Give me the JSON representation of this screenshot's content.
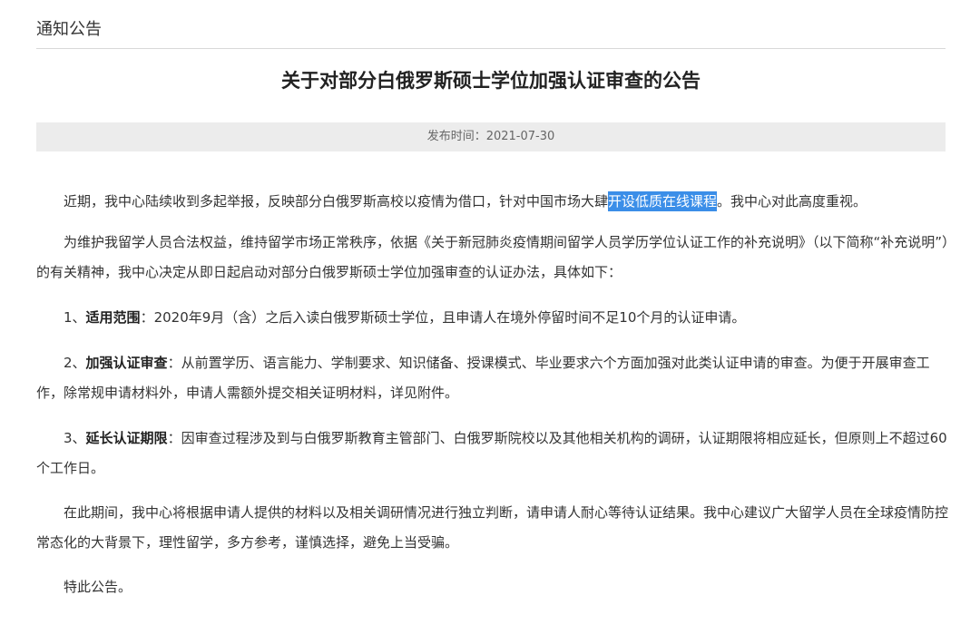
{
  "section": {
    "title": "通知公告"
  },
  "article": {
    "title": "关于对部分白俄罗斯硕士学位加强认证审查的公告",
    "publish_label": "发布时间：",
    "publish_date": "2021-07-30",
    "p1": {
      "before": "近期，我中心陆续收到多起举报，反映部分白俄罗斯高校以疫情为借口，针对中国市场大肆",
      "highlighted": "开设低质在线课程",
      "after": "。我中心对此高度重视。"
    },
    "p2": "为维护我留学人员合法权益，维持留学市场正常秩序，依据《关于新冠肺炎疫情期间留学人员学历学位认证工作的补充说明》（以下简称“补充说明”）的有关精神，我中心决定从即日起启动对部分白俄罗斯硕士学位加强审查的认证办法，具体如下：",
    "p3": {
      "num": "1、",
      "bold": "适用范围",
      "text": "：2020年9月（含）之后入读白俄罗斯硕士学位，且申请人在境外停留时间不足10个月的认证申请。"
    },
    "p4": {
      "num": "2、",
      "bold": "加强认证审查",
      "text": "：从前置学历、语言能力、学制要求、知识储备、授课模式、毕业要求六个方面加强对此类认证申请的审查。为便于开展审查工作，除常规申请材料外，申请人需额外提交相关证明材料，详见附件。"
    },
    "p5": {
      "num": "3、",
      "bold": "延长认证期限",
      "text": "：因审查过程涉及到与白俄罗斯教育主管部门、白俄罗斯院校以及其他相关机构的调研，认证期限将相应延长，但原则上不超过60个工作日。"
    },
    "p6": "在此期间，我中心将根据申请人提供的材料以及相关调研情况进行独立判断，请申请人耐心等待认证结果。我中心建议广大留学人员在全球疫情防控常态化的大背景下，理性留学，多方参考，谨慎选择，避免上当受骗。",
    "p7": "特此公告。"
  },
  "colors": {
    "highlight": "#3b8ee8",
    "meta_bar_bg": "#ececec",
    "divider": "#d9d9d9"
  }
}
